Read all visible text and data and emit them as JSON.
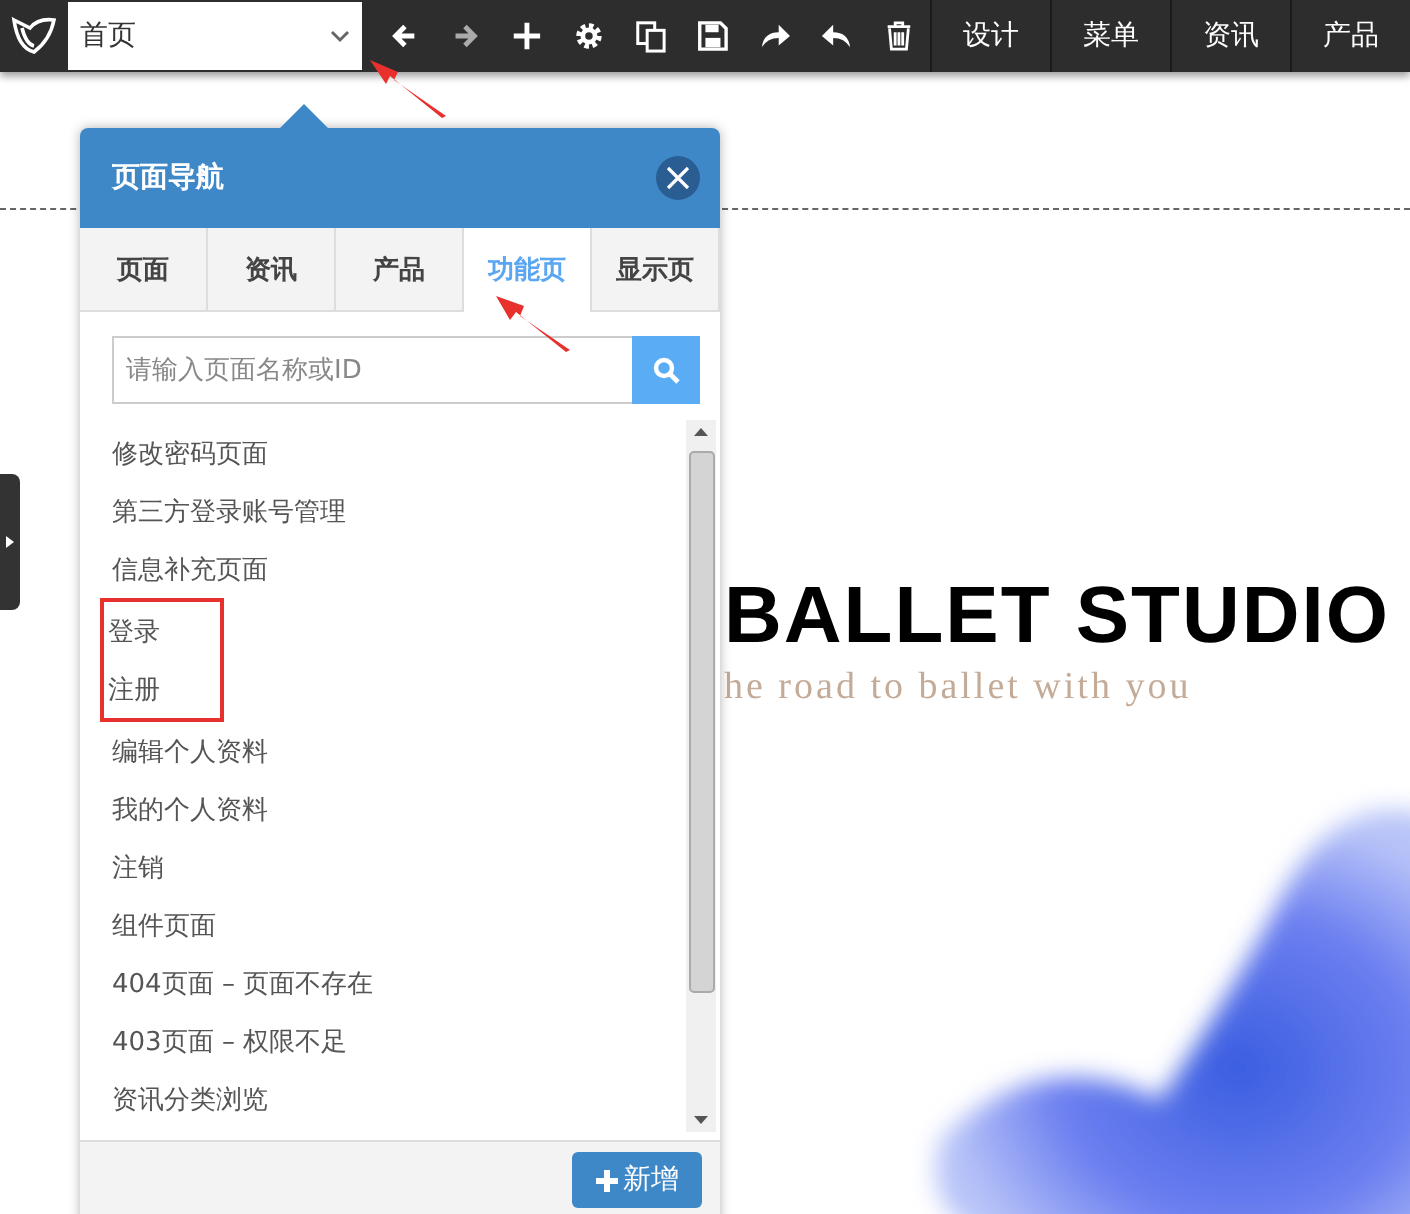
{
  "toolbar": {
    "page_select": {
      "value": "首页"
    },
    "menu": [
      {
        "label": "设计"
      },
      {
        "label": "菜单"
      },
      {
        "label": "资讯"
      },
      {
        "label": "产品"
      }
    ]
  },
  "hero": {
    "title": "BALLET STUDIO",
    "tagline": "he road to ballet with you"
  },
  "page_nav": {
    "title": "页面导航",
    "tabs": [
      {
        "label": "页面",
        "selected": false
      },
      {
        "label": "资讯",
        "selected": false
      },
      {
        "label": "产品",
        "selected": false
      },
      {
        "label": "功能页",
        "selected": true
      },
      {
        "label": "显示页",
        "selected": false
      }
    ],
    "search": {
      "placeholder": "请输入页面名称或ID"
    },
    "items": [
      {
        "label": "修改密码页面",
        "boxed": false
      },
      {
        "label": "第三方登录账号管理",
        "boxed": false
      },
      {
        "label": "信息补充页面",
        "boxed": false
      },
      {
        "label": "登录",
        "boxed": true
      },
      {
        "label": "注册",
        "boxed": true
      },
      {
        "label": "编辑个人资料",
        "boxed": false
      },
      {
        "label": "我的个人资料",
        "boxed": false
      },
      {
        "label": "注销",
        "boxed": false
      },
      {
        "label": "组件页面",
        "boxed": false
      },
      {
        "label": "404页面 – 页面不存在",
        "boxed": false
      },
      {
        "label": "403页面 – 权限不足",
        "boxed": false
      },
      {
        "label": "资讯分类浏览",
        "boxed": false
      }
    ],
    "add_button": {
      "label": "新增"
    }
  }
}
